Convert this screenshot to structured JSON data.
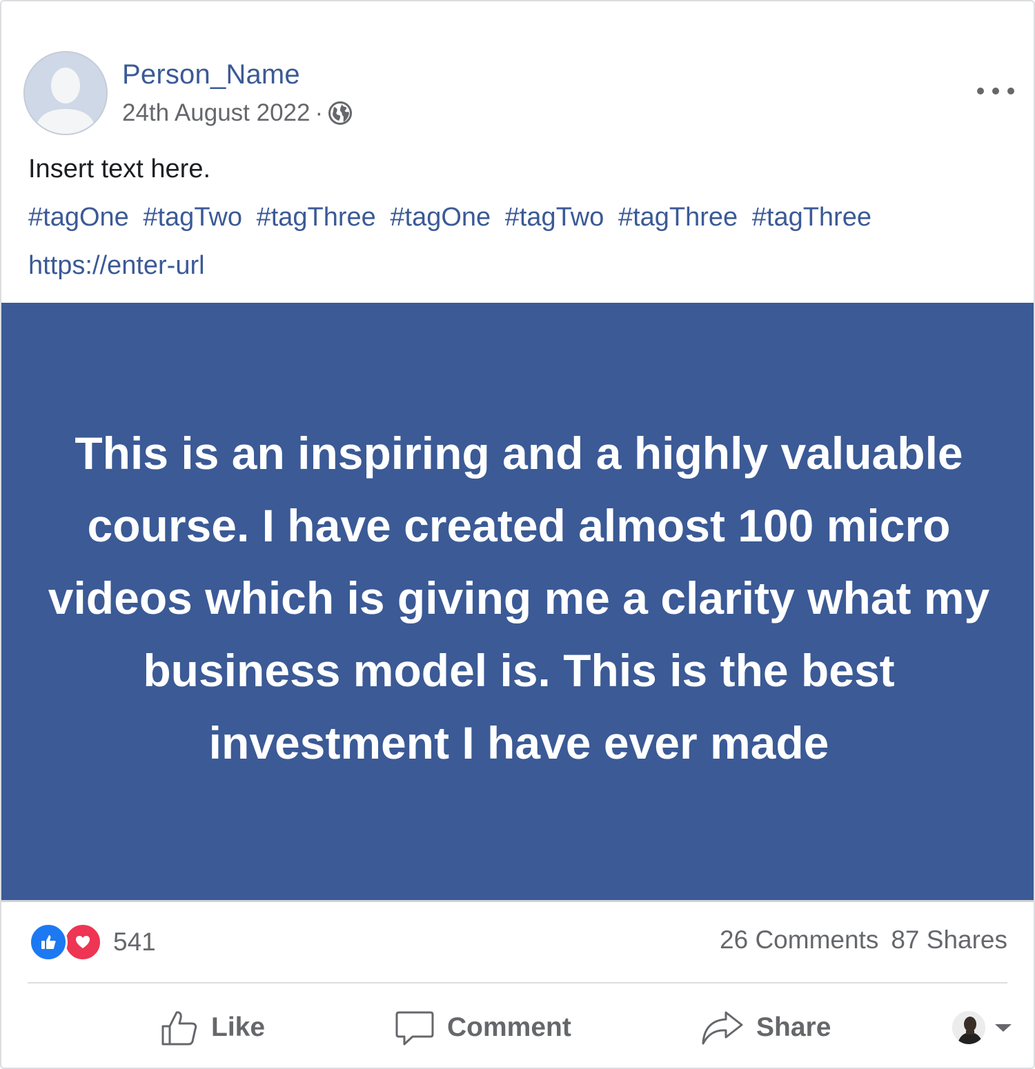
{
  "post": {
    "author": "Person_Name",
    "date": "24th August 2022",
    "separator": "·",
    "privacy_icon": "globe-icon",
    "text": "Insert text here.",
    "hashtags": [
      "#tagOne",
      "#tagTwo",
      "#tagThree",
      "#tagOne",
      "#tagTwo",
      "#tagThree",
      "#tagThree"
    ],
    "url": "https://enter-url",
    "quote": "This is an inspiring and a highly valuable course. I have created almost 100 micro videos which is giving me a clarity what my business model is. This is the best investment I have ever made"
  },
  "engagement": {
    "reactions_count": "541",
    "comments": "26 Comments",
    "shares": "87 Shares"
  },
  "actions": {
    "like": "Like",
    "comment": "Comment",
    "share": "Share"
  },
  "colors": {
    "brand_blue": "#3b5a96",
    "like_blue": "#1d79f2",
    "love_red": "#ee3553",
    "muted_text": "#65676b"
  }
}
